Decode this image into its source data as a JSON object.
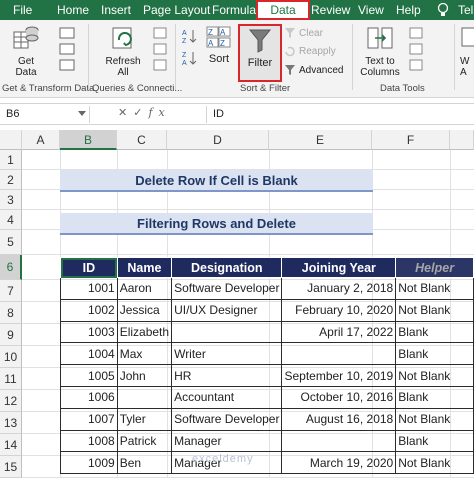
{
  "ribbon_tabs": [
    "File",
    "Home",
    "Insert",
    "Page Layout",
    "Formulas",
    "Data",
    "Review",
    "View",
    "Help",
    "Tel"
  ],
  "ribbon": {
    "get_data": {
      "line1": "Get",
      "line2": "Data"
    },
    "refresh_all": {
      "line1": "Refresh",
      "line2": "All"
    },
    "sort": "Sort",
    "filter": "Filter",
    "clear": "Clear",
    "reapply": "Reapply",
    "advanced": "Advanced",
    "text_to_columns": {
      "line1": "Text to",
      "line2": "Columns"
    },
    "what_if": {
      "line1": "W",
      "line2": "A"
    },
    "groups": {
      "get_transform": "Get & Transform Data",
      "queries": "Queries & Connecti...",
      "sort_filter": "Sort & Filter",
      "data_tools": "Data Tools"
    }
  },
  "formula_bar": {
    "name_box": "B6",
    "fx": "fx",
    "value": "ID"
  },
  "columns": [
    "A",
    "B",
    "C",
    "D",
    "E",
    "F"
  ],
  "rows": [
    "1",
    "2",
    "3",
    "4",
    "5",
    "6",
    "7",
    "8",
    "9",
    "10",
    "11",
    "12",
    "13",
    "14",
    "15"
  ],
  "sheet": {
    "title1": "Delete Row If Cell is Blank",
    "title2": "Filtering Rows and Delete",
    "headers": [
      "ID",
      "Name",
      "Designation",
      "Joining Year",
      "Helper"
    ],
    "data": [
      [
        "1001",
        "Aaron",
        "Software Developer",
        "January 2, 2018",
        "Not Blank"
      ],
      [
        "1002",
        "Jessica",
        "UI/UX Designer",
        "February 10, 2020",
        "Not Blank"
      ],
      [
        "1003",
        "Elizabeth",
        "",
        "April 17, 2022",
        "Blank"
      ],
      [
        "1004",
        "Max",
        "Writer",
        "",
        "Blank"
      ],
      [
        "1005",
        "John",
        "HR",
        "September 10, 2019",
        "Not Blank"
      ],
      [
        "1006",
        "",
        "Accountant",
        "October 10, 2016",
        "Blank"
      ],
      [
        "1007",
        "Tyler",
        "Software Developer",
        "August 16, 2018",
        "Not Blank"
      ],
      [
        "1008",
        "Patrick",
        "Manager",
        "",
        "Blank"
      ],
      [
        "1009",
        "Ben",
        "Manager",
        "March 19, 2020",
        "Not Blank"
      ]
    ]
  },
  "watermark": "exceldemy",
  "colors": {
    "excel_green": "#217346",
    "header_navy": "#1f2a5f",
    "highlight_red": "#d9262a",
    "banner_blue": "#dbe3f3"
  }
}
